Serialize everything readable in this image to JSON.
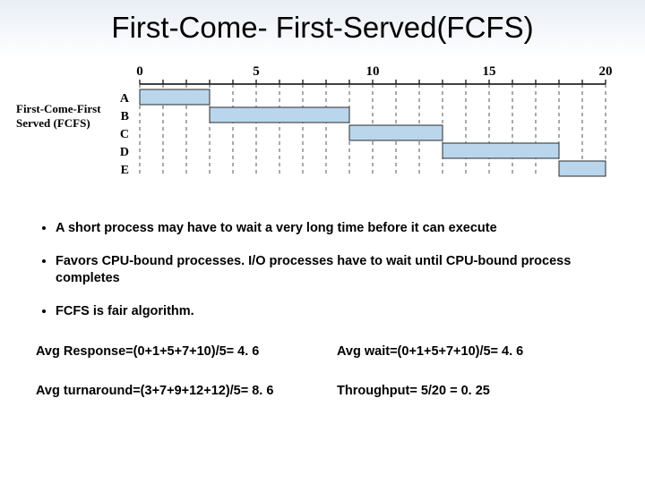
{
  "title": "First-Come- First-Served(FCFS)",
  "side_label": "First-Come-First Served (FCFS)",
  "bullets": [
    "A short process may have to wait a very long time before it can execute",
    "Favors CPU-bound processes. I/O processes have to wait until CPU-bound process completes",
    "FCFS is  fair algorithm."
  ],
  "metrics": {
    "avg_response": "Avg Response=(0+1+5+7+10)/5= 4. 6",
    "avg_wait": "Avg wait=(0+1+5+7+10)/5= 4. 6",
    "avg_turnaround": "Avg turnaround=(3+7+9+12+12)/5= 8. 6",
    "throughput": "Throughput= 5/20 = 0. 25"
  },
  "chart_data": {
    "type": "bar",
    "xlabel": "",
    "ylabel": "",
    "title": "",
    "categories": [
      "A",
      "B",
      "C",
      "D",
      "E"
    ],
    "x_ticks_major": [
      0,
      5,
      10,
      15,
      20
    ],
    "x_range": [
      0,
      20
    ],
    "series": [
      {
        "name": "A",
        "start": 0,
        "end": 3
      },
      {
        "name": "B",
        "start": 3,
        "end": 9
      },
      {
        "name": "C",
        "start": 9,
        "end": 13
      },
      {
        "name": "D",
        "start": 13,
        "end": 18
      },
      {
        "name": "E",
        "start": 18,
        "end": 20
      }
    ],
    "bar_fill": "#b9d6ec",
    "bar_stroke": "#2b2b2b"
  }
}
